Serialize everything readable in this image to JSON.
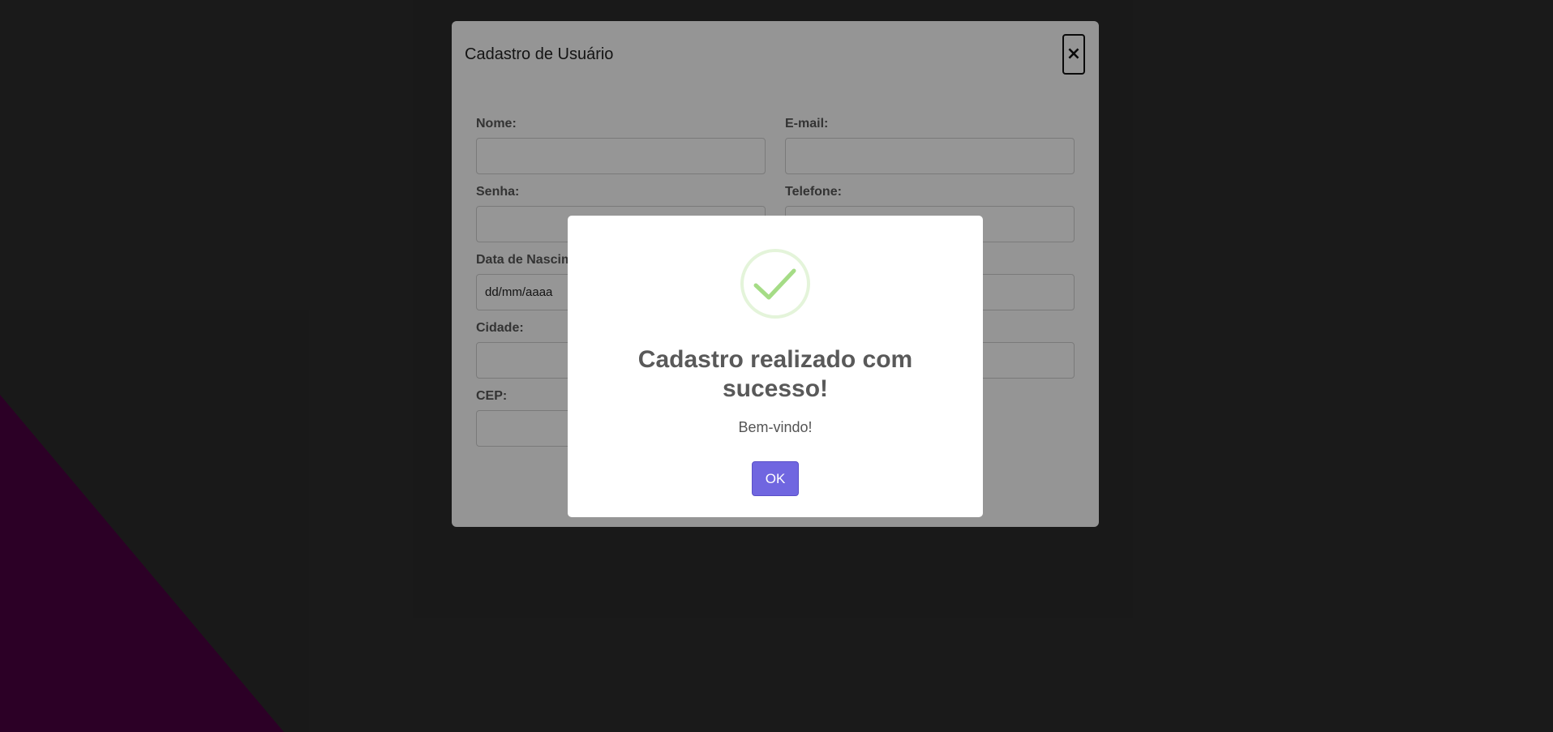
{
  "form": {
    "title": "Cadastro de Usuário",
    "close_label": "×",
    "fields": {
      "nome": {
        "label": "Nome:",
        "value": ""
      },
      "email": {
        "label": "E-mail:",
        "value": ""
      },
      "senha": {
        "label": "Senha:",
        "value": ""
      },
      "telefone": {
        "label": "Telefone:",
        "value": ""
      },
      "data_nascimento": {
        "label": "Data de Nascim",
        "value": "dd/mm/aaaa"
      },
      "data_right": {
        "value": ""
      },
      "cidade": {
        "label": "Cidade:",
        "value": ""
      },
      "cidade_right": {
        "value": ""
      },
      "cep": {
        "label": "CEP:",
        "value": ""
      }
    }
  },
  "dialog": {
    "icon": "success-check-icon",
    "title": "Cadastro realizado com sucesso!",
    "text": "Bem-vindo!",
    "ok_label": "OK"
  },
  "colors": {
    "background": "#2b2b2b",
    "accent_purple": "#4a0040",
    "button": "#7066e0",
    "success": "#a5dc86"
  }
}
